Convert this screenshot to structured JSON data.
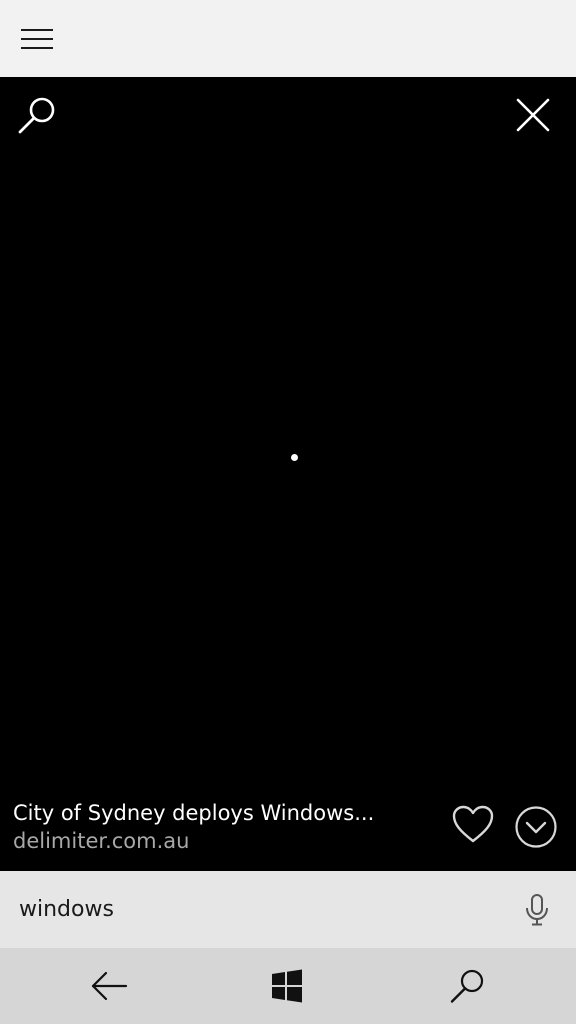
{
  "topbar": {
    "menu_icon": "hamburger-menu-icon"
  },
  "viewer": {
    "search_icon": "search-icon",
    "close_icon": "close-icon",
    "caption": {
      "title": "City of Sydney deploys Windows...",
      "source": "delimiter.com.au"
    },
    "favorite_icon": "heart-icon",
    "expand_icon": "chevron-down-circle-icon"
  },
  "searchbar": {
    "value": "windows",
    "mic_icon": "microphone-icon"
  },
  "navbar": {
    "back_icon": "back-arrow-icon",
    "start_icon": "windows-logo-icon",
    "search_icon": "search-icon"
  },
  "colors": {
    "topbar_bg": "#f2f2f2",
    "viewer_bg": "#000000",
    "searchbar_bg": "#e6e6e6",
    "navbar_bg": "#d6d6d6",
    "caption_title": "#ffffff",
    "caption_source": "#a8a8a8"
  }
}
